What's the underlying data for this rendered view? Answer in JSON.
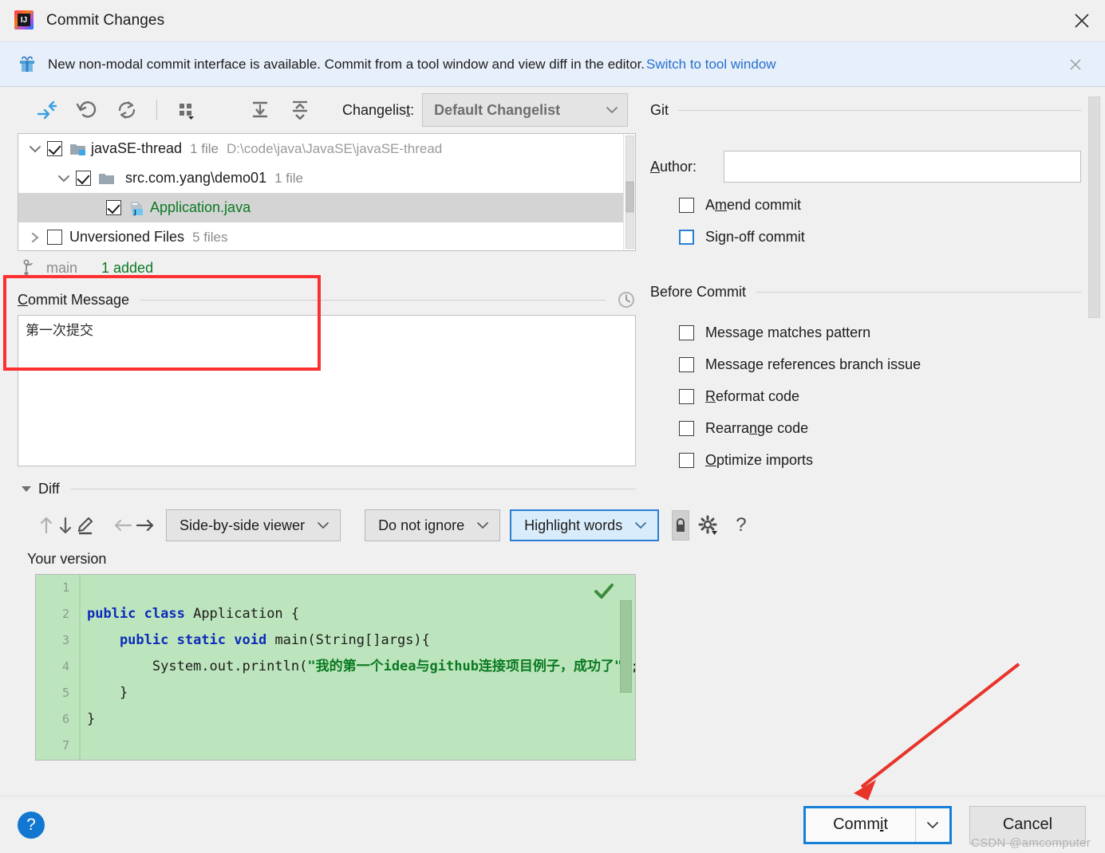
{
  "window": {
    "title": "Commit Changes",
    "app_icon": "intellij-idea-icon",
    "close_icon": "close-icon"
  },
  "banner": {
    "icon": "gift-icon",
    "text": "New non-modal commit interface is available. Commit from a tool window and view diff in the editor.",
    "link": "Switch to tool window",
    "close_icon": "close-icon"
  },
  "vcs_toolbar": {
    "buttons": [
      {
        "name": "collapse-changes-icon",
        "title": "Show Diff"
      },
      {
        "name": "revert-icon",
        "title": "Revert"
      },
      {
        "name": "refresh-icon",
        "title": "Refresh"
      },
      {
        "name": "group-by-icon",
        "title": "Group By"
      },
      {
        "name": "expand-all-icon",
        "title": "Expand All"
      },
      {
        "name": "collapse-all-icon",
        "title": "Collapse All"
      }
    ],
    "changelist_label": "Changelist:",
    "changelist_value": "Default Changelist"
  },
  "file_tree": {
    "rows": [
      {
        "indent": 0,
        "expander": "chevron-down",
        "checked": true,
        "icon": "module-folder-icon",
        "name": "javaSE-thread",
        "meta": "1 file",
        "path": "D:\\code\\java\\JavaSE\\javaSE-thread",
        "selected": false,
        "green": false
      },
      {
        "indent": 1,
        "expander": "chevron-down",
        "checked": true,
        "icon": "folder-icon",
        "name": "src.com.yang\\demo01",
        "meta": "1 file",
        "path": "",
        "selected": false,
        "green": false
      },
      {
        "indent": 2,
        "expander": "none",
        "checked": true,
        "icon": "java-file-icon",
        "name": "Application.java",
        "meta": "",
        "path": "",
        "selected": true,
        "green": true
      },
      {
        "indent": 0,
        "expander": "chevron-right",
        "checked": false,
        "icon": "none",
        "name": "Unversioned Files",
        "meta": "5 files",
        "path": "",
        "selected": false,
        "green": false
      }
    ]
  },
  "branch_bar": {
    "icon": "git-branch-icon",
    "branch": "main",
    "status": "1 added"
  },
  "commit_message": {
    "label": "Commit Message",
    "label_mnemonic": "C",
    "history_icon": "clock-icon",
    "value": "第一次提交",
    "highlight_color": "#fc3030"
  },
  "diff": {
    "section_label": "Diff",
    "collapse_icon": "triangle-down-icon",
    "toolbar": [
      {
        "name": "previous-difference-icon"
      },
      {
        "name": "next-difference-icon"
      },
      {
        "name": "edit-source-icon"
      },
      {
        "name": "arrow-left-icon"
      },
      {
        "name": "arrow-right-icon"
      }
    ],
    "viewer_mode": "Side-by-side viewer",
    "ignore_mode": "Do not ignore",
    "highlight_mode": "Highlight words",
    "lock_icon": "lock-icon",
    "settings_icon": "gear-icon",
    "help_icon": "question-mark-icon",
    "pane_title": "Your version",
    "line_numbers": [
      "1",
      "2",
      "3",
      "4",
      "5",
      "6",
      "7"
    ],
    "code_lines": [
      {
        "n": "1",
        "tokens": []
      },
      {
        "n": "2",
        "tokens": [
          {
            "t": "public ",
            "c": "kw"
          },
          {
            "t": "class ",
            "c": "kw"
          },
          {
            "t": "Application {",
            "c": "pl"
          }
        ]
      },
      {
        "n": "3",
        "tokens": [
          {
            "t": "    public ",
            "c": "kw"
          },
          {
            "t": "static ",
            "c": "kw"
          },
          {
            "t": "void ",
            "c": "kw"
          },
          {
            "t": "main(String[]args){",
            "c": "pl"
          }
        ]
      },
      {
        "n": "4",
        "tokens": [
          {
            "t": "        System.out.println(",
            "c": "pl"
          },
          {
            "t": "\"我的第一个idea与github连接项目例子，成功了\"",
            "c": "st"
          },
          {
            "t": ");",
            "c": "pl"
          }
        ]
      },
      {
        "n": "5",
        "tokens": [
          {
            "t": "    }",
            "c": "pl"
          }
        ]
      },
      {
        "n": "6",
        "tokens": [
          {
            "t": "}",
            "c": "pl"
          }
        ]
      },
      {
        "n": "7",
        "tokens": []
      }
    ],
    "status_icon": "green-check-icon",
    "background_color": "#bde5bd"
  },
  "git_panel": {
    "section_title": "Git",
    "author_label": "Author:",
    "author_mnemonic": "A",
    "author_value": "",
    "checkboxes": [
      {
        "name": "amend-commit",
        "label": "Amend commit",
        "mnemonic": "m",
        "checked": false,
        "focused": false
      },
      {
        "name": "sign-off-commit",
        "label": "Sign-off commit",
        "mnemonic": "g",
        "checked": false,
        "focused": true
      }
    ],
    "before_commit_title": "Before Commit",
    "before_commit_options": [
      {
        "name": "message-matches-pattern",
        "label": "Message matches pattern",
        "checked": false
      },
      {
        "name": "message-references-branch-issue",
        "label": "Message references branch issue",
        "checked": false
      },
      {
        "name": "reformat-code",
        "label": "Reformat code",
        "mnemonic": "R",
        "checked": false
      },
      {
        "name": "rearrange-code",
        "label": "Rearrange code",
        "mnemonic": "n",
        "checked": false
      },
      {
        "name": "optimize-imports",
        "label": "Optimize imports",
        "mnemonic": "O",
        "checked": false
      }
    ]
  },
  "footer": {
    "help_label": "?",
    "commit_label": "Commit",
    "commit_mnemonic": "i",
    "commit_dropdown_icon": "chevron-down-icon",
    "cancel_label": "Cancel",
    "watermark": "CSDN @amcomputer",
    "accent_color": "#1580d8"
  }
}
